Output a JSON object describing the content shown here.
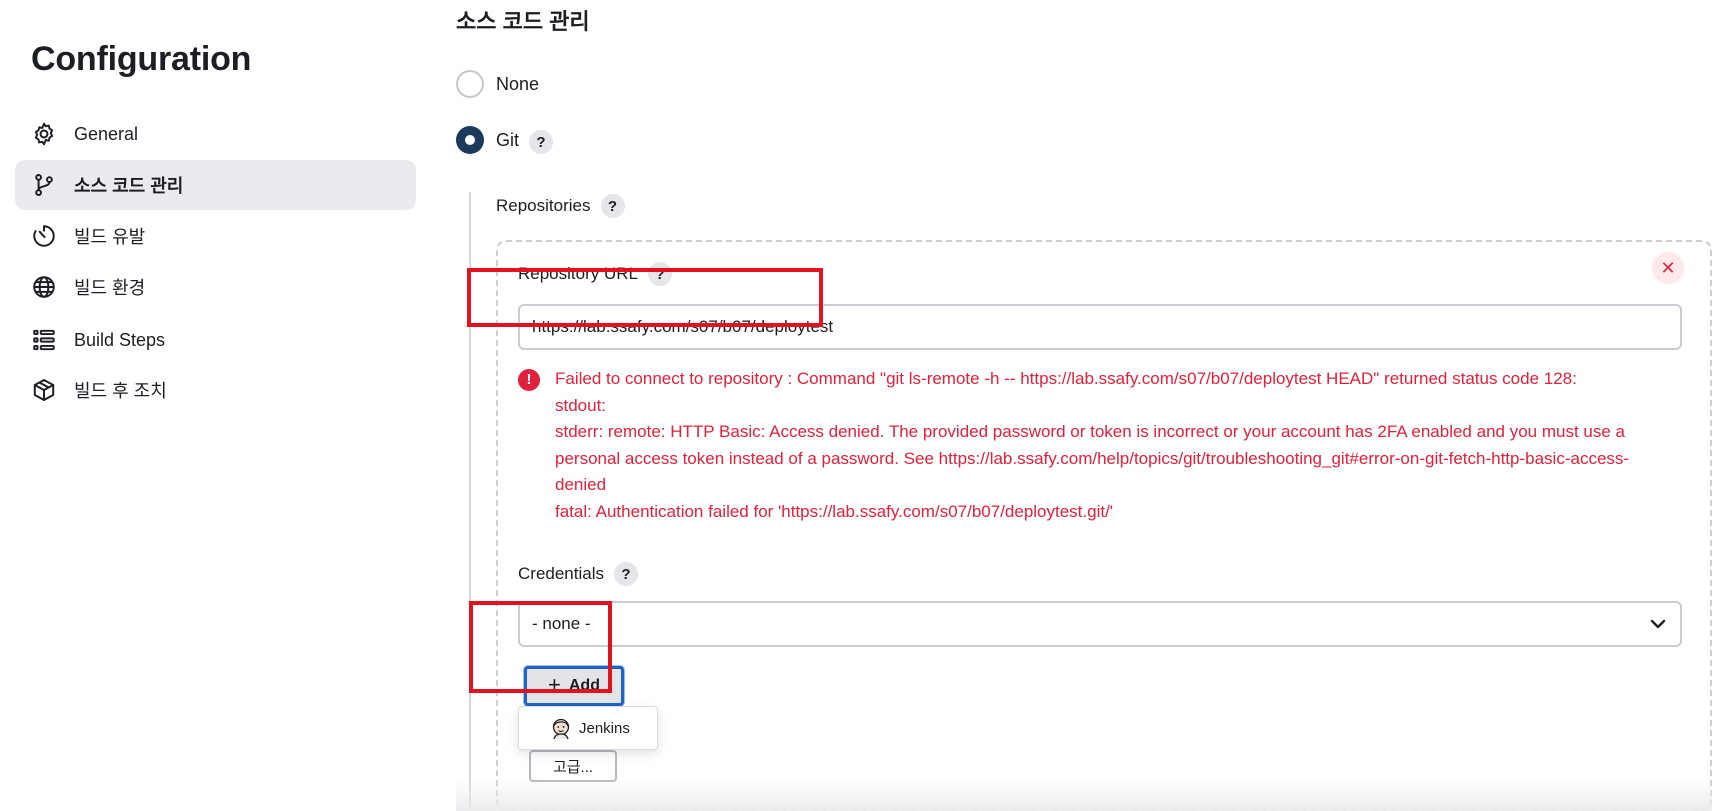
{
  "sidebar": {
    "title": "Configuration",
    "items": [
      {
        "label": "General",
        "icon": "gear-icon",
        "active": false
      },
      {
        "label": "소스 코드 관리",
        "icon": "git-branch-icon",
        "active": true
      },
      {
        "label": "빌드 유발",
        "icon": "timer-icon",
        "active": false
      },
      {
        "label": "빌드 환경",
        "icon": "globe-icon",
        "active": false
      },
      {
        "label": "Build Steps",
        "icon": "list-steps-icon",
        "active": false
      },
      {
        "label": "빌드 후 조치",
        "icon": "package-icon",
        "active": false
      }
    ]
  },
  "main": {
    "section_title": "소스 코드 관리",
    "scm_options": [
      {
        "label": "None",
        "selected": false
      },
      {
        "label": "Git",
        "selected": true
      }
    ],
    "help_glyph": "?",
    "repositories_label": "Repositories",
    "repository": {
      "url_label": "Repository URL",
      "url_value": "https://lab.ssafy.com/s07/b07/deploytest",
      "remove_glyph": "✕",
      "error_icon": "!",
      "error_lines": [
        "Failed to connect to repository : Command \"git ls-remote -h -- https://lab.ssafy.com/s07/b07/deploytest HEAD\" returned status code 128:",
        "stdout:",
        "stderr: remote: HTTP Basic: Access denied. The provided password or token is incorrect or your account has 2FA enabled and you must use a personal access token instead of a password. See https://lab.ssafy.com/help/topics/git/troubleshooting_git#error-on-git-fetch-http-basic-access-denied",
        "fatal: Authentication failed for 'https://lab.ssafy.com/s07/b07/deploytest.git/'"
      ],
      "credentials_label": "Credentials",
      "credentials_value": "- none -",
      "add_button": "Add",
      "add_plus": "+",
      "dropdown_item": "Jenkins",
      "advanced_button": "고급..."
    }
  },
  "colors": {
    "accent": "#1b3a5c",
    "error": "#e1213b",
    "highlight": "#e1131f",
    "focus": "#1e63c8"
  }
}
